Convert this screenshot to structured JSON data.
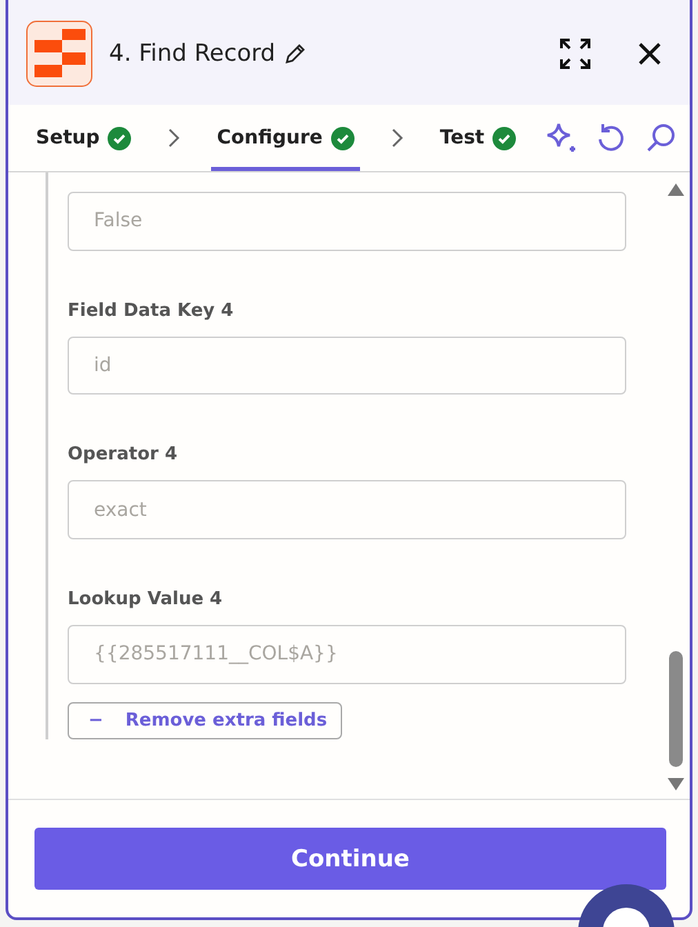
{
  "header": {
    "title": "4. Find Record"
  },
  "steps": [
    {
      "label": "Setup",
      "done": true,
      "selected": false
    },
    {
      "label": "Configure",
      "done": true,
      "selected": true
    },
    {
      "label": "Test",
      "done": true,
      "selected": false
    }
  ],
  "fields": [
    {
      "value": "False"
    },
    {
      "label": "Field Data Key 4",
      "value": "id"
    },
    {
      "label": "Operator 4",
      "value": "exact"
    },
    {
      "label": "Lookup Value 4",
      "value": "{{285517111__COL$A}}"
    }
  ],
  "remove_button": {
    "icon": "−",
    "label": "Remove extra fields"
  },
  "continue_button": {
    "label": "Continue"
  }
}
